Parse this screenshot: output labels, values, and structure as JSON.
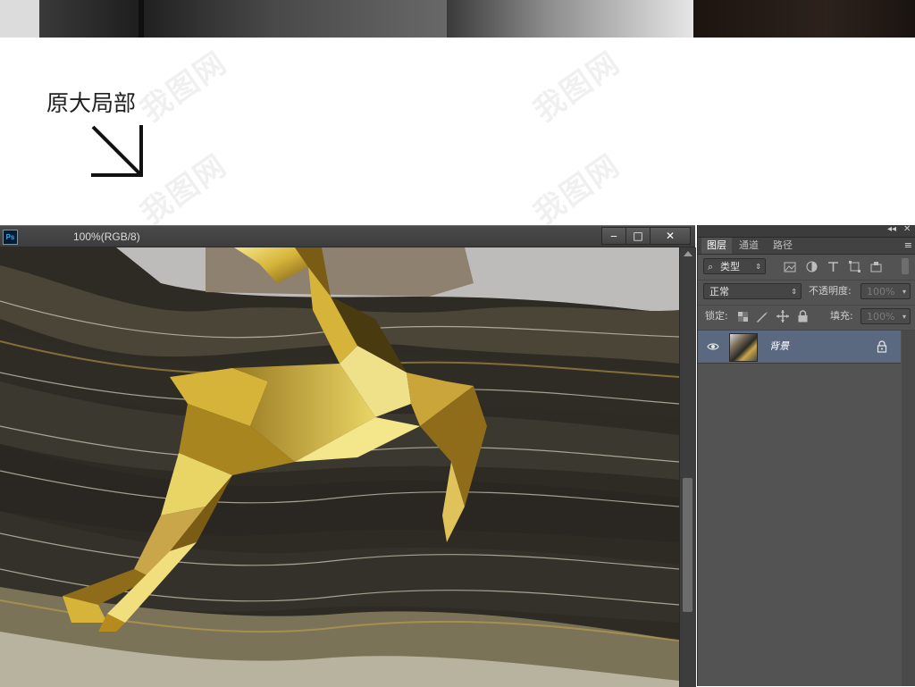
{
  "page": {
    "section_label": "原大局部",
    "watermark_text": "我图网"
  },
  "ps_window": {
    "app_logo": "Ps",
    "doc_title": "100%(RGB/8)",
    "minimize_label": "‒",
    "maximize_label": "□",
    "close_label": "✕"
  },
  "layers_panel": {
    "collapse_label": "◂◂",
    "close_label": "✕",
    "tabs": [
      {
        "label": "图层",
        "active": true
      },
      {
        "label": "通道",
        "active": false
      },
      {
        "label": "路径",
        "active": false
      }
    ],
    "menu_label": "≡",
    "filter": {
      "search_icon": "⌕",
      "value": "类型",
      "icons": [
        "image-filter-icon",
        "adjustment-filter-icon",
        "type-filter-icon",
        "shape-filter-icon",
        "smart-object-filter-icon"
      ]
    },
    "blend_mode": "正常",
    "opacity_label": "不透明度:",
    "opacity_value": "100%",
    "lock_label": "锁定:",
    "fill_label": "填充:",
    "fill_value": "100%",
    "layers": [
      {
        "name": "背景",
        "visible": true,
        "locked": true
      }
    ]
  },
  "colors": {
    "ps_panel_bg": "#535353",
    "selected_layer": "#5a6880",
    "ps_blue": "#31a8ff"
  }
}
